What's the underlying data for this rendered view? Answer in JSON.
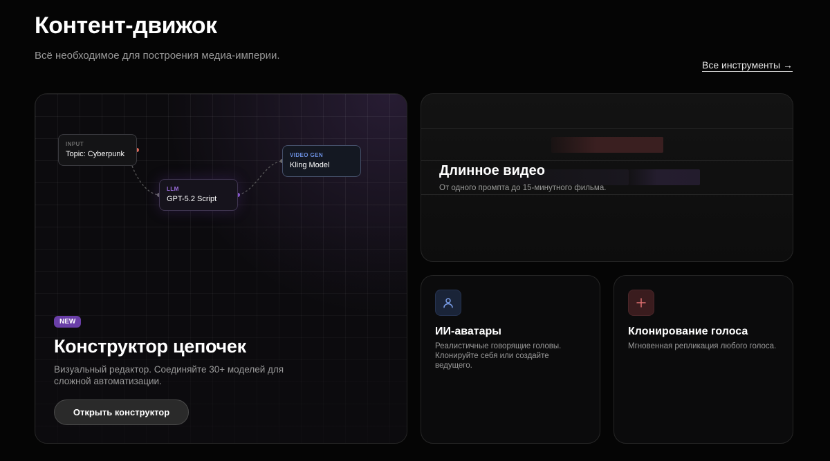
{
  "header": {
    "title": "Контент-движок",
    "subtitle": "Всё необходимое для построения медиа-империи.",
    "all_tools_link": "Все инструменты →"
  },
  "chain_builder": {
    "nodes": [
      {
        "type": "INPUT",
        "value": "Topic: Cyberpunk"
      },
      {
        "type": "LLM",
        "value": "GPT-5.2 Script"
      },
      {
        "type": "VIDEO GEN",
        "value": "Kling Model"
      }
    ],
    "badge": "NEW",
    "title": "Конструктор цепочек",
    "description": "Визуальный редактор. Соединяйте 30+ моделей для сложной автоматизации.",
    "button_label": "Открыть конструктор"
  },
  "long_video": {
    "title": "Длинное видео",
    "description": "От одного промпта до 15-минутного фильма."
  },
  "avatars": {
    "icon": "user-icon",
    "title": "ИИ-аватары",
    "description": "Реалистичные говорящие головы. Клонируйте себя или создайте ведущего."
  },
  "voice_cloning": {
    "icon": "plus-icon",
    "title": "Клонирование голоса",
    "description": "Мгновенная репликация любого голоса."
  },
  "colors": {
    "background": "#050505",
    "accent_purple": "#6a3fa8",
    "accent_blue": "#6b8fe0",
    "accent_red": "#e06a6a"
  }
}
